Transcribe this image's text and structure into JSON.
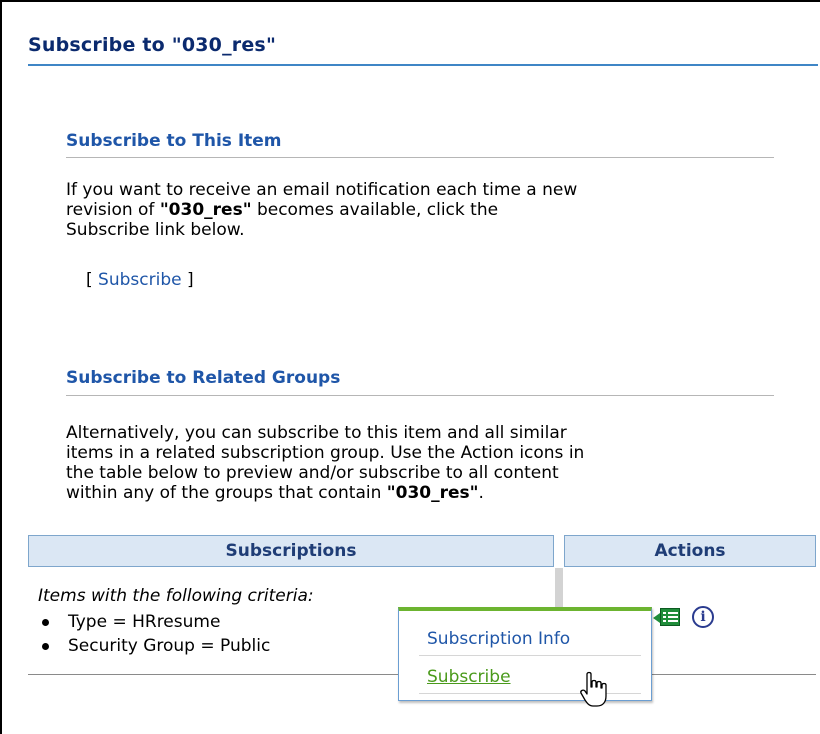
{
  "page": {
    "title": "Subscribe to \"030_res\""
  },
  "item_section": {
    "heading": "Subscribe to This Item",
    "para_line1": "If you want to receive an email notification each time a new",
    "para_line2_before": "revision of ",
    "para_item_name": "\"030_res\"",
    "para_line2_after": " becomes available, click the",
    "para_line3": "Subscribe link below.",
    "link_open": "[ ",
    "link_label": "Subscribe",
    "link_close": " ]"
  },
  "groups_section": {
    "heading": "Subscribe to Related Groups",
    "para_line1": "Alternatively, you can subscribe to this item and all similar",
    "para_line2": "items in a related subscription group. Use the Action icons in",
    "para_line3": "the table below to preview and/or subscribe to all content",
    "para_line4_before": "within any of the groups that contain ",
    "para_item_name": "\"030_res\"",
    "para_line4_after": "."
  },
  "table": {
    "columns": [
      "Subscriptions",
      "Actions"
    ],
    "rows": [
      {
        "criteria_label": "Items with the following criteria:",
        "criteria": [
          "Type = HRresume",
          "Security Group = Public"
        ]
      }
    ]
  },
  "popup_menu": {
    "items": [
      "Subscription Info",
      "Subscribe"
    ],
    "hovered_item": "Subscribe"
  },
  "icons": {
    "action_menu": "list-menu-icon",
    "info": "info-icon",
    "cursor": "hand-pointer-icon"
  },
  "colors": {
    "title": "#0b2a6e",
    "heading": "#1f56a8",
    "link": "#1f56a8",
    "hover_link": "#4a9a1b",
    "table_header_bg": "#dbe7f4",
    "popup_accent": "#6cb430"
  }
}
